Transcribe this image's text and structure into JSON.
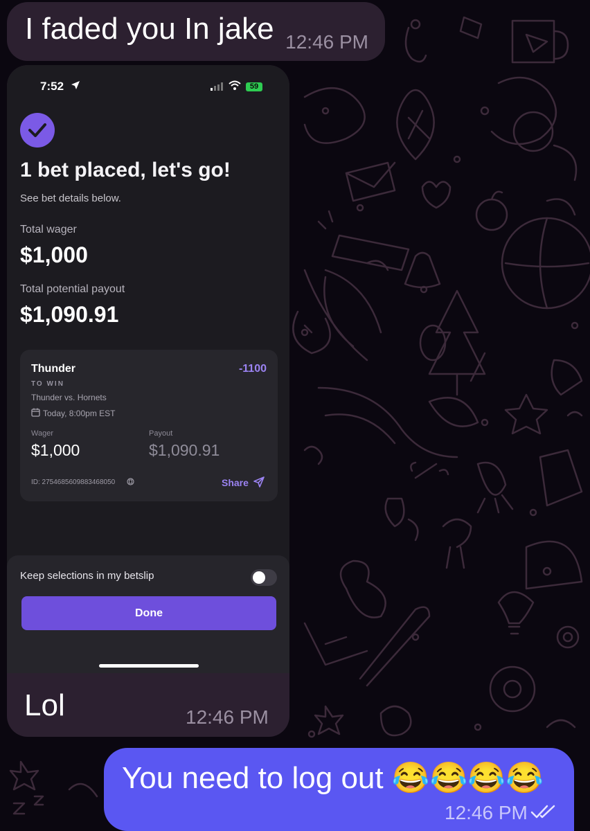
{
  "chat": {
    "incoming_top": {
      "text": "I faded you In jake",
      "time": "12:46 PM"
    },
    "media_message": {
      "caption": "Lol",
      "time": "12:46 PM"
    },
    "outgoing": {
      "text": "You need to log out 😂😂😂😂",
      "time": "12:46 PM",
      "status_icon": "double-check-icon"
    }
  },
  "screenshot": {
    "status_time": "7:52",
    "battery": "59",
    "headline": "1 bet placed, let's go!",
    "subline": "See bet details below.",
    "total_wager_label": "Total wager",
    "total_wager": "$1,000",
    "potential_payout_label": "Total potential payout",
    "potential_payout": "$1,090.91",
    "bet": {
      "team": "Thunder",
      "odds": "-1100",
      "market": "TO WIN",
      "matchup": "Thunder vs. Hornets",
      "time": "Today, 8:00pm EST",
      "wager_label": "Wager",
      "wager": "$1,000",
      "payout_label": "Payout",
      "payout": "$1,090.91",
      "id": "ID: 2754685609883468050",
      "share_label": "Share"
    },
    "keep_selections_label": "Keep selections in my betslip",
    "keep_selections_on": false,
    "done_label": "Done",
    "accent_color": "#7b5ae6"
  }
}
